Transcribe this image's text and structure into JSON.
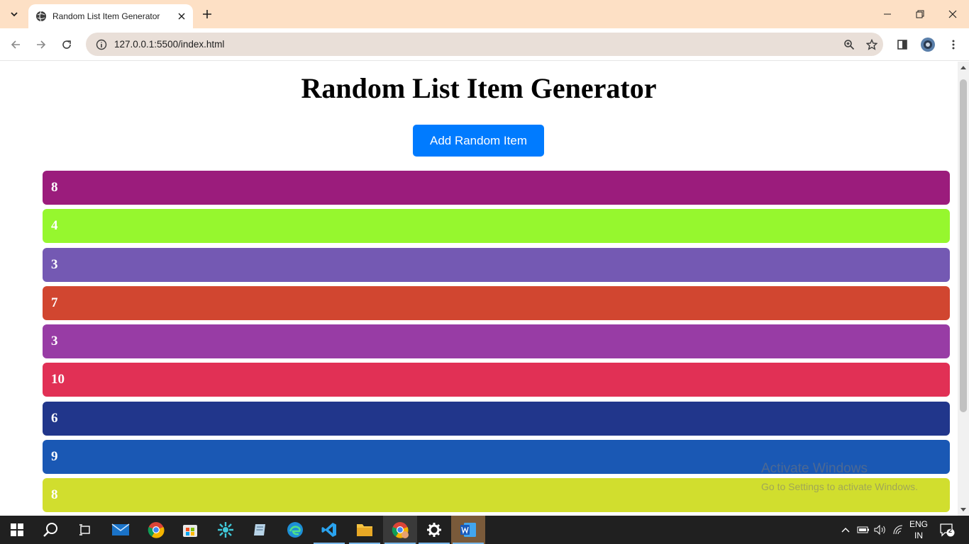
{
  "browser": {
    "tab_title": "Random List Item Generator",
    "url": "127.0.0.1:5500/index.html"
  },
  "page": {
    "title": "Random List Item Generator",
    "button_label": "Add Random Item",
    "items": [
      {
        "value": "8",
        "color": "#9b1c7c"
      },
      {
        "value": "4",
        "color": "#96f72e"
      },
      {
        "value": "3",
        "color": "#7459b3"
      },
      {
        "value": "7",
        "color": "#d14630"
      },
      {
        "value": "3",
        "color": "#983ca5"
      },
      {
        "value": "10",
        "color": "#e13055"
      },
      {
        "value": "6",
        "color": "#21368b"
      },
      {
        "value": "9",
        "color": "#1a58b4"
      },
      {
        "value": "8",
        "color": "#d1de2e"
      }
    ]
  },
  "watermark": {
    "line1": "Activate Windows",
    "line2": "Go to Settings to activate Windows."
  },
  "taskbar": {
    "lang_line1": "ENG",
    "lang_line2": "IN",
    "notification_count": "2",
    "icons": [
      "windows-start-icon",
      "search-icon",
      "task-view-icon",
      "mail-icon",
      "chrome-icon",
      "store-icon",
      "app-icon",
      "notes-icon",
      "edge-icon",
      "vscode-icon",
      "file-explorer-icon",
      "chrome-profile-icon",
      "settings-icon",
      "word-icon"
    ]
  }
}
